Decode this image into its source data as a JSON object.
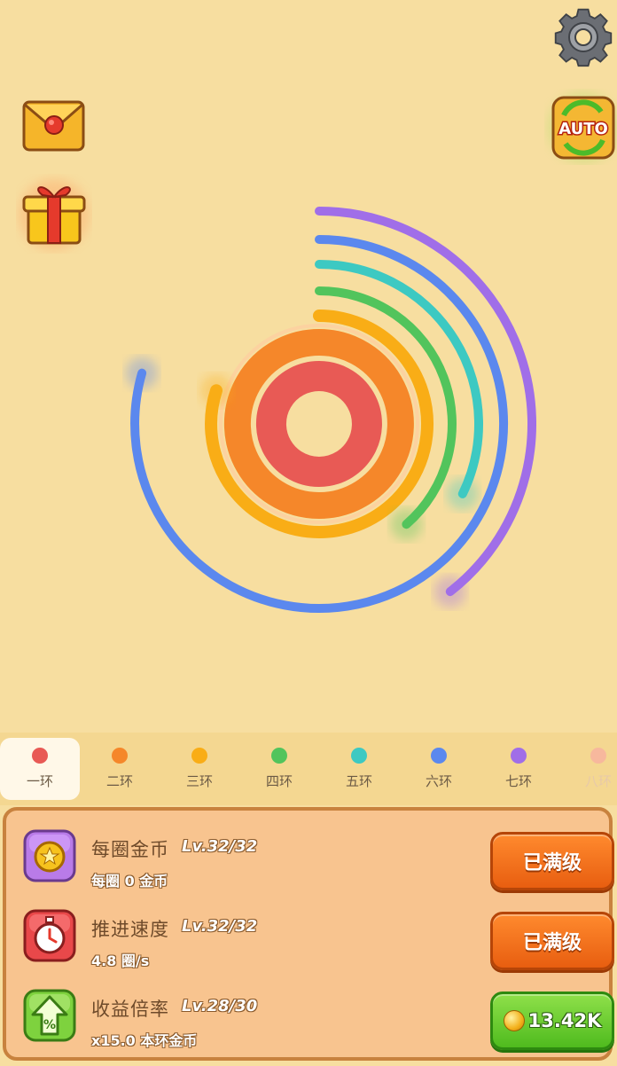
{
  "top_icons": {
    "settings": "gear-icon",
    "mail": "envelope-icon",
    "gift": "gift-icon",
    "auto": {
      "icon": "auto-icon",
      "label": "AUTO"
    }
  },
  "rings": [
    {
      "name": "一环",
      "color": "#e85a55"
    },
    {
      "name": "二环",
      "color": "#f5872a"
    },
    {
      "name": "三环",
      "color": "#f9ad16"
    },
    {
      "name": "四环",
      "color": "#52c45c"
    },
    {
      "name": "五环",
      "color": "#3dc9c2"
    },
    {
      "name": "六环",
      "color": "#5b88ee"
    },
    {
      "name": "七环",
      "color": "#a06ee8"
    },
    {
      "name": "八环",
      "color": "#f7b0a0"
    }
  ],
  "active_tab": 0,
  "upgrades": [
    {
      "icon": "coin-icon",
      "title": "每圈金币",
      "level": "Lv.32/32",
      "sub": "每圈 0 金币",
      "button": "已满级",
      "button_style": "orange"
    },
    {
      "icon": "stopwatch-icon",
      "title": "推进速度",
      "level": "Lv.32/32",
      "sub": "4.8 圈/s",
      "button": "已满级",
      "button_style": "orange"
    },
    {
      "icon": "upgrade-percent-icon",
      "title": "收益倍率",
      "level": "Lv.28/30",
      "sub": "x15.0 本环金币",
      "button": "13.42K",
      "button_style": "green"
    }
  ]
}
